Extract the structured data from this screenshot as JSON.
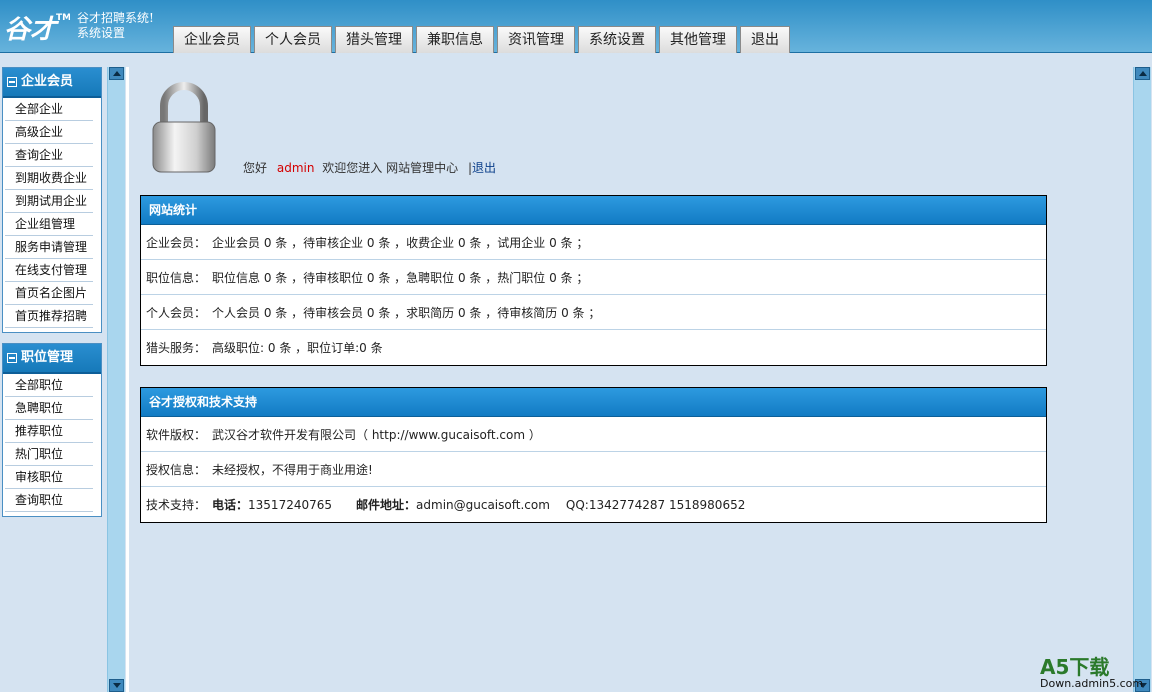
{
  "header": {
    "logo_text": "谷才™",
    "system_title_1": "谷才招聘系统!",
    "system_title_2": "系统设置",
    "tabs": [
      "企业会员",
      "个人会员",
      "猎头管理",
      "兼职信息",
      "资讯管理",
      "系统设置",
      "其他管理",
      "退出"
    ]
  },
  "sidebar": {
    "groups": [
      {
        "title": "企业会员",
        "items": [
          "全部企业",
          "高级企业",
          "查询企业",
          "到期收费企业",
          "到期试用企业",
          "企业组管理",
          "服务申请管理",
          "在线支付管理",
          "首页名企图片",
          "首页推荐招聘"
        ]
      },
      {
        "title": "职位管理",
        "items": [
          "全部职位",
          "急聘职位",
          "推荐职位",
          "热门职位",
          "审核职位",
          "查询职位"
        ]
      }
    ]
  },
  "welcome": {
    "greeting": "您好",
    "username": "admin",
    "message": "欢迎您进入  网站管理中心",
    "separator": "|",
    "logout": "退出"
  },
  "stats_panel": {
    "title": "网站统计",
    "rows": [
      {
        "label": "企业会员：",
        "text": "企业会员  0 条 ，待审核企业  0 条 ，收费企业  0 条 ，试用企业  0 条 ；"
      },
      {
        "label": "职位信息：",
        "text": "职位信息  0 条 ，待审核职位  0 条 ，急聘职位  0 条 ，热门职位  0 条 ；"
      },
      {
        "label": "个人会员：",
        "text": "个人会员  0 条 ，待审核会员  0 条 ，求职简历  0 条 ，待审核简历  0 条 ；"
      },
      {
        "label": "猎头服务：",
        "text": "高级职位: 0 条 ，职位订单:0 条"
      }
    ]
  },
  "support_panel": {
    "title": "谷才授权和技术支持",
    "copyright_label": "软件版权：",
    "copyright_text": "武汉谷才软件开发有限公司（ http://www.gucaisoft.com ）",
    "license_label": "授权信息：",
    "license_text": "未经授权，不得用于商业用途!",
    "support_label": "技术支持：",
    "phone_label": "电话：",
    "phone": "13517240765",
    "email_label": "邮件地址：",
    "email": "admin@gucaisoft.com",
    "qq": "QQ:1342774287  1518980652"
  },
  "watermark": {
    "brand": "A5下载",
    "url": "Down.admin5.com"
  }
}
